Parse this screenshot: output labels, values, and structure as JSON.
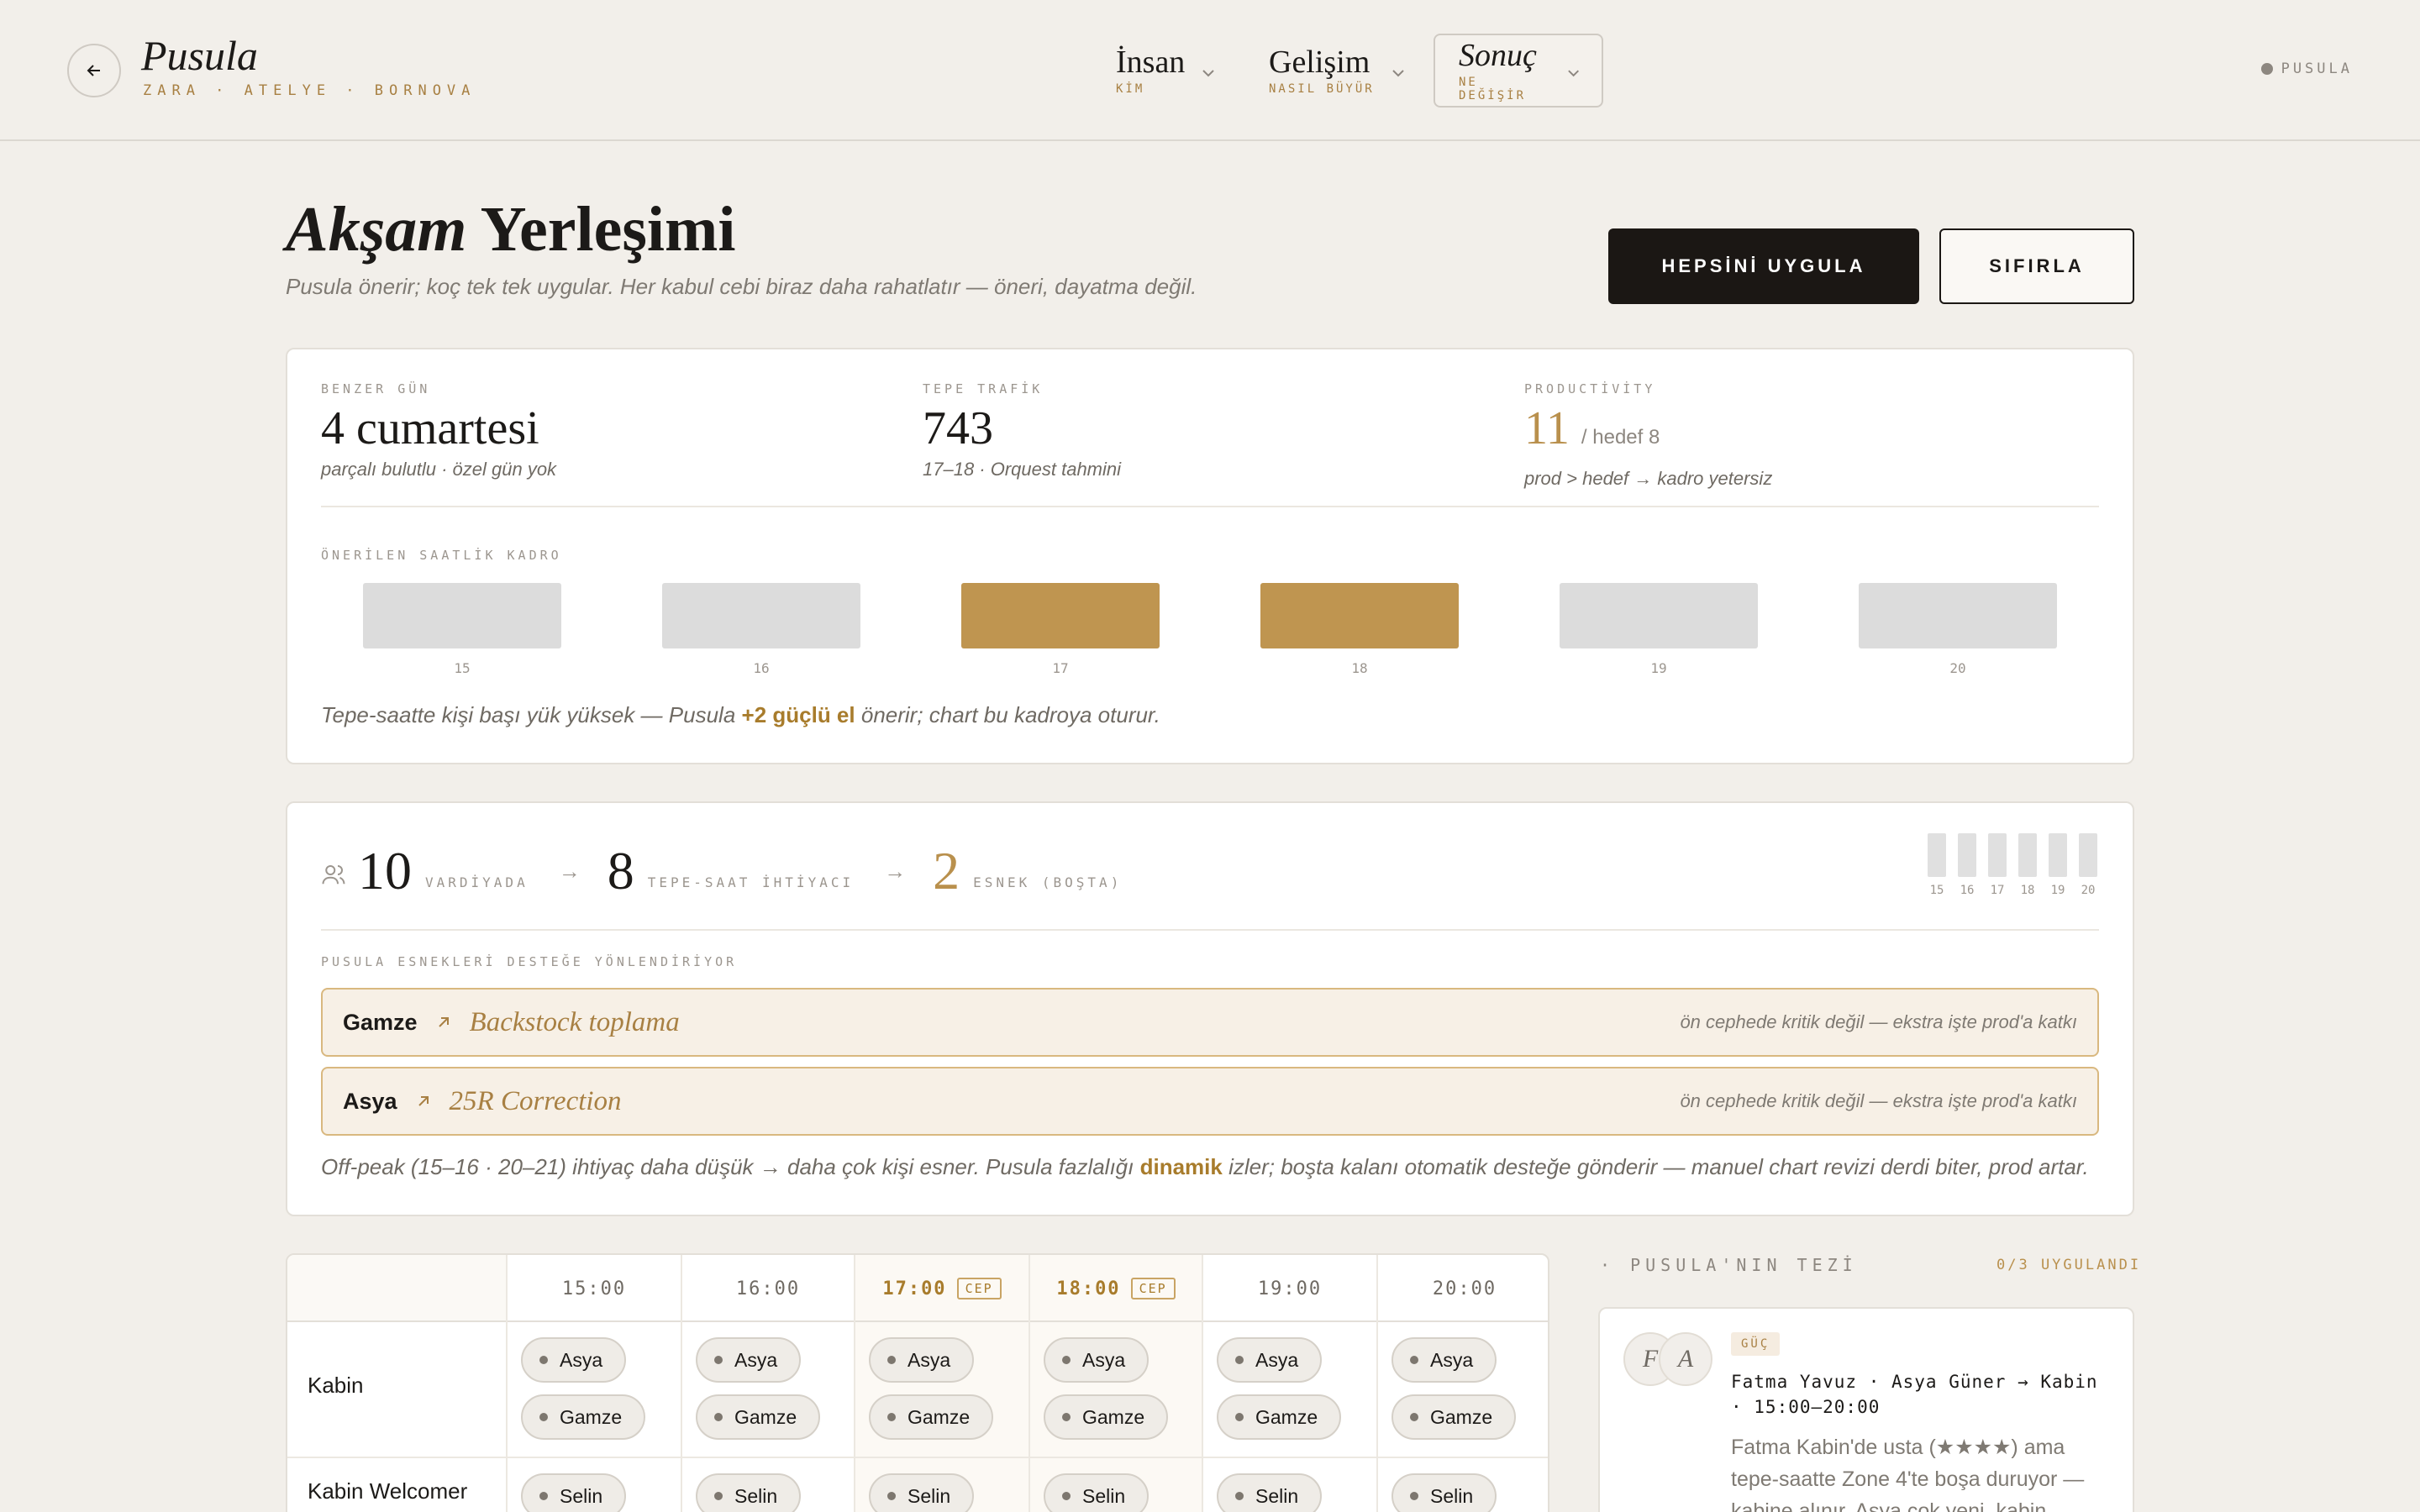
{
  "header": {
    "brand": "Pusula",
    "subtitle": "ZARA · ATELYE · BORNOVA",
    "nav": [
      {
        "label": "İnsan",
        "sub": "KİM"
      },
      {
        "label": "Gelişim",
        "sub": "NASIL BÜYÜR"
      },
      {
        "label": "Sonuç",
        "sub": "NE DEĞİŞİR"
      }
    ],
    "status": "PUSULA"
  },
  "page": {
    "title_italic": "Akşam",
    "title_rest": "Yerleşimi",
    "description": "Pusula önerir; koç tek tek uygular. Her kabul cebi biraz daha rahatlatır — öneri, dayatma değil.",
    "apply_all": "HEPSİNİ UYGULA",
    "reset": "SIFIRLA"
  },
  "forecast": {
    "similar_day": {
      "label": "BENZER GÜN",
      "value": "4 cumartesi",
      "note": "parçalı bulutlu · özel gün yok"
    },
    "peak_traffic": {
      "label": "TEPE TRAFİK",
      "value": "743",
      "note": "17–18 · Orquest tahmini"
    },
    "productivity": {
      "label": "PRODUCTİVİTY",
      "value": "11",
      "target": "/ hedef 8",
      "note": "prod > hedef → kadro yetersiz"
    },
    "staffing_label": "ÖNERİLEN SAATLİK KADRO",
    "bars": [
      {
        "hour": "15",
        "peak": false
      },
      {
        "hour": "16",
        "peak": false
      },
      {
        "hour": "17",
        "peak": true
      },
      {
        "hour": "18",
        "peak": true
      },
      {
        "hour": "19",
        "peak": false
      },
      {
        "hour": "20",
        "peak": false
      }
    ],
    "footer_pre": "Tepe-saatte kişi başı yük yüksek — Pusula",
    "footer_bold": "+2 güçlü el",
    "footer_post": "önerir; chart bu kadroya oturur."
  },
  "capacity": {
    "on_shift": {
      "value": "10",
      "label": "VARDİYADA"
    },
    "peak_need": {
      "value": "8",
      "label": "TEPE-SAAT İHTİYACI"
    },
    "flex": {
      "value": "2",
      "label": "ESNEK (BOŞTA)"
    },
    "mini_hours": [
      "15",
      "16",
      "17",
      "18",
      "19",
      "20"
    ],
    "section_label": "PUSULA ESNEKLERİ DESTEĞE YÖNLENDİRİYOR",
    "assignments": [
      {
        "name": "Gamze",
        "task": "Backstock toplama",
        "reason": "ön cephede kritik değil — ekstra işte prod'a katkı"
      },
      {
        "name": "Asya",
        "task": "25R Correction",
        "reason": "ön cephede kritik değil — ekstra işte prod'a katkı"
      }
    ],
    "footer_pre": "Off-peak (15–16 · 20–21) ihtiyaç daha düşük → daha çok kişi esner. Pusula fazlalığı",
    "footer_bold": "dinamik",
    "footer_post": "izler; boşta kalanı otomatik desteğe gönderir — manuel chart revizi derdi biter, prod artar."
  },
  "schedule": {
    "hours": [
      {
        "label": "15:00",
        "peak": false
      },
      {
        "label": "16:00",
        "peak": false
      },
      {
        "label": "17:00",
        "peak": true
      },
      {
        "label": "18:00",
        "peak": true
      },
      {
        "label": "19:00",
        "peak": false
      },
      {
        "label": "20:00",
        "peak": false
      }
    ],
    "peak_tag": "CEP",
    "rows": [
      {
        "role": "Kabin",
        "people": [
          "Asya",
          "Gamze"
        ]
      },
      {
        "role": "Kabin Welcomer",
        "people": [
          "Selin"
        ]
      }
    ]
  },
  "thesis": {
    "label": "· PUSULA'NIN TEZİ",
    "count": "0/3 UYGULANDI",
    "card": {
      "avatar_1": "F",
      "avatar_2": "A",
      "tag": "GÜÇ",
      "headline": "Fatma Yavuz · Asya Güner → Kabin · 15:00–20:00",
      "body": "Fatma Kabin'de usta (★★★★) ama tepe-saatte Zone 4'te boşa duruyor — kabine alınır, Asya çok yeni, kabin"
    }
  },
  "colors": {
    "accent": "#bf9550",
    "dark": "#1b1714",
    "background": "#f2efea"
  }
}
